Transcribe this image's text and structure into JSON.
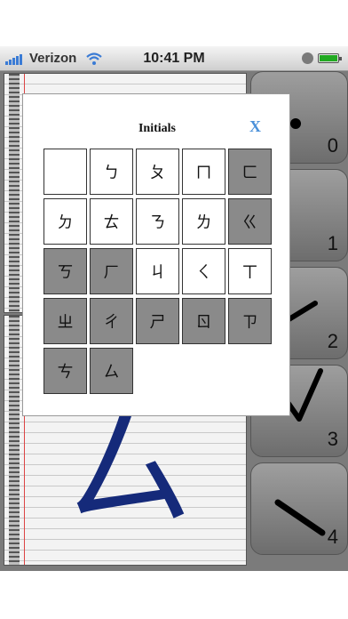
{
  "status_bar": {
    "carrier": "Verizon",
    "time": "10:41 PM"
  },
  "notebook": {
    "drawn_character": "ㄙ"
  },
  "stroke_buttons": [
    {
      "number": "0"
    },
    {
      "number": "1"
    },
    {
      "number": "2"
    },
    {
      "number": "3"
    },
    {
      "number": "4"
    }
  ],
  "dialog": {
    "title": "Initials",
    "close_label": "X",
    "cells": [
      {
        "char": "",
        "shade": "white"
      },
      {
        "char": "ㄅ",
        "shade": "white"
      },
      {
        "char": "ㄆ",
        "shade": "white"
      },
      {
        "char": "ㄇ",
        "shade": "white"
      },
      {
        "char": "ㄈ",
        "shade": "gray"
      },
      {
        "char": "ㄉ",
        "shade": "white"
      },
      {
        "char": "ㄊ",
        "shade": "white"
      },
      {
        "char": "ㄋ",
        "shade": "white"
      },
      {
        "char": "ㄌ",
        "shade": "white"
      },
      {
        "char": "ㄍ",
        "shade": "gray"
      },
      {
        "char": "ㄎ",
        "shade": "gray"
      },
      {
        "char": "ㄏ",
        "shade": "gray"
      },
      {
        "char": "ㄐ",
        "shade": "white"
      },
      {
        "char": "ㄑ",
        "shade": "white"
      },
      {
        "char": "ㄒ",
        "shade": "white"
      },
      {
        "char": "ㄓ",
        "shade": "gray"
      },
      {
        "char": "ㄔ",
        "shade": "gray"
      },
      {
        "char": "ㄕ",
        "shade": "gray"
      },
      {
        "char": "ㄖ",
        "shade": "gray"
      },
      {
        "char": "ㄗ",
        "shade": "gray"
      },
      {
        "char": "ㄘ",
        "shade": "gray"
      },
      {
        "char": "ㄙ",
        "shade": "gray"
      }
    ]
  },
  "colors": {
    "ink": "#152a7a",
    "close_button": "#4a90d9",
    "unavailable_cell": "#8a8a8a"
  }
}
